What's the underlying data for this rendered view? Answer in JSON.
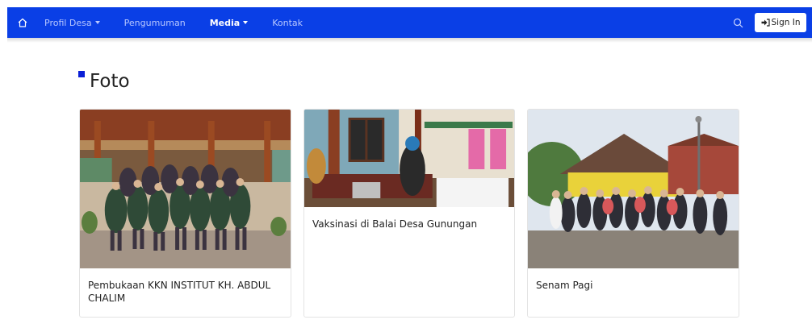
{
  "navbar": {
    "items": [
      {
        "label": "Profil Desa",
        "has_dropdown": true,
        "active": false
      },
      {
        "label": "Pengumuman",
        "has_dropdown": false,
        "active": false
      },
      {
        "label": "Media",
        "has_dropdown": true,
        "active": true
      },
      {
        "label": "Kontak",
        "has_dropdown": false,
        "active": false
      }
    ],
    "signin_label": "Sign In",
    "icons": {
      "home": "home-icon",
      "search": "search-icon",
      "signin": "sign-in-icon"
    },
    "colors": {
      "background": "#0a3fe6",
      "text": "#b9c8ff",
      "active_text": "#ffffff"
    }
  },
  "page": {
    "title": "Foto",
    "accent_color": "#0a1fd6"
  },
  "cards": [
    {
      "title": "Pembukaan KKN INSTITUT KH. ABDUL CHALIM",
      "photo": "group photo of students in green jackets at pendopo"
    },
    {
      "title": "Vaksinasi di Balai Desa Gunungan",
      "photo": "vaccination activity inside village hall"
    },
    {
      "title": "Senam Pagi",
      "photo": "group photo after morning exercise in front of building"
    }
  ]
}
